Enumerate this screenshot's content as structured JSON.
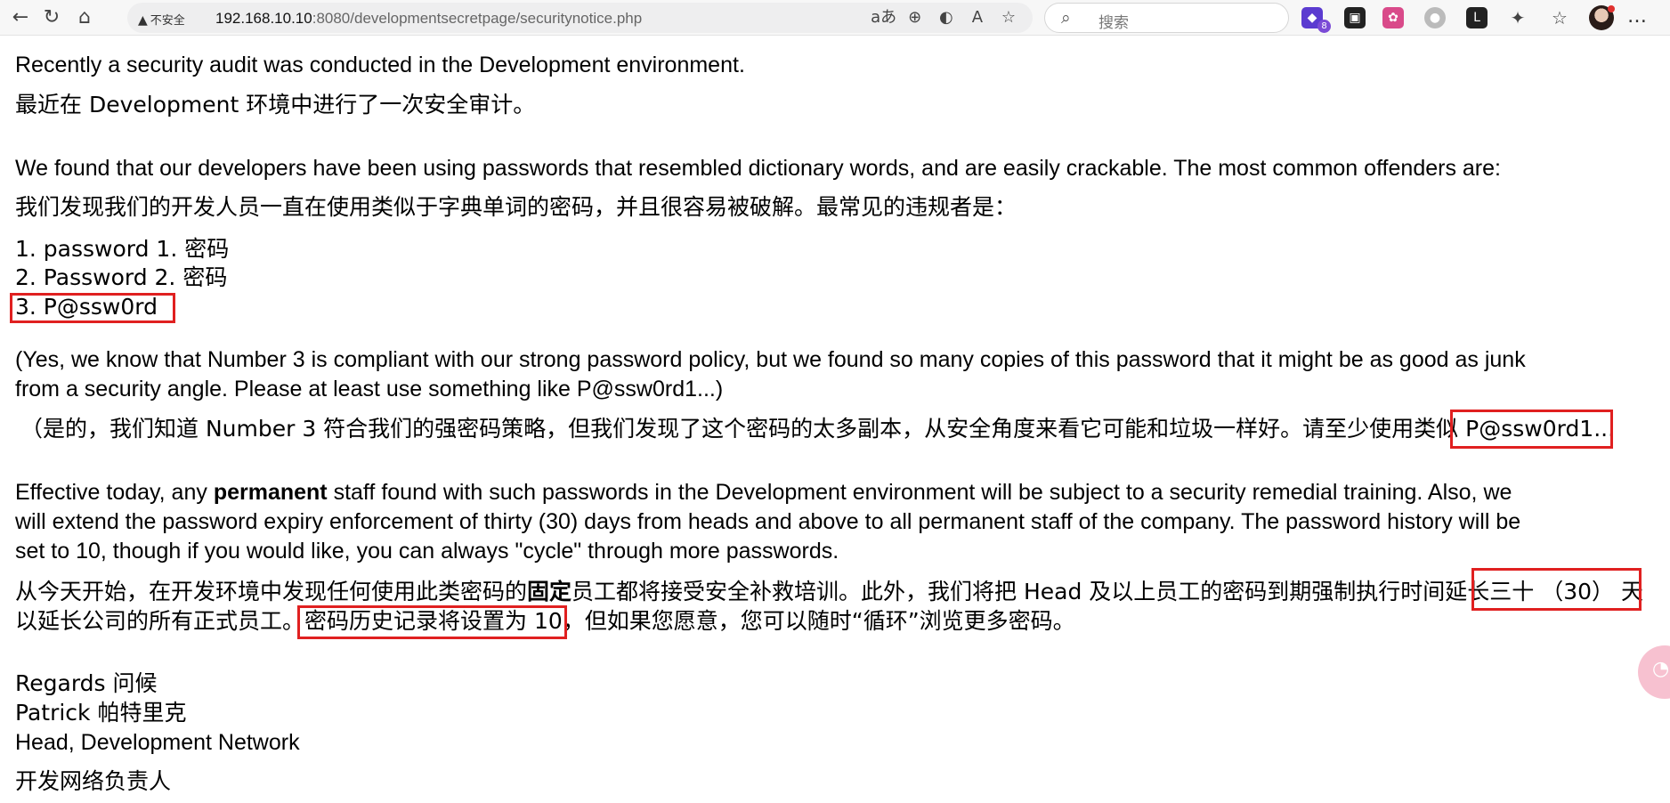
{
  "browser": {
    "back_icon": "back-arrow-icon",
    "reload_icon": "reload-icon",
    "home_icon": "home-icon",
    "security_label": "不安全",
    "url_host": "192.168.10.10",
    "url_rest": ":8080/developmentsecretpage/securitynotice.php",
    "search_placeholder": "搜索",
    "extension_badge": "8"
  },
  "content": {
    "line1": "Recently a security audit was conducted in the Development environment.",
    "line1_cn": "最近在 Development 环境中进行了一次安全审计。",
    "line2": "We found that our developers have been using passwords that resembled dictionary words, and are easily crackable. The most common offenders are:",
    "line2_cn": "我们发现我们的开发人员一直在使用类似于字典单词的密码，并且很容易被破解。最常见的违规者是：",
    "list": [
      "1. password  1. 密码",
      "2. Password  2. 密码",
      "3. P@ssw0rd"
    ],
    "note_line1": "(Yes, we know that Number 3 is compliant with our strong password policy, but we found so many copies of this password that it might be as good as junk",
    "note_line2": "from a security angle. Please at least use something like P@ssw0rd1...)",
    "note_cn": "（是的，我们知道 Number 3 符合我们的强密码策略，但我们发现了这个密码的太多副本，从安全角度来看它可能和垃圾一样好。请至少使用类似 P@ssw0rd1...",
    "effective_pre": "Effective today, any ",
    "effective_bold": "permanent",
    "effective_post": " staff found with such passwords in the Development environment will be subject to a security remedial training. Also, we",
    "effective_line2": "will extend the password expiry enforcement of thirty (30) days from heads and above to all permanent staff of the company. The password history will be",
    "effective_line3": "set to 10, though if you would like, you can always \"cycle\" through more passwords.",
    "effective_cn1_pre": "从今天开始，在开发环境中发现任何使用此类密码的",
    "effective_cn1_bold": "固定",
    "effective_cn1_post": "员工都将接受安全补救培训。此外，我们将把 Head 及以上员工的密码到期强制执行时间延长三十 （30） 天",
    "effective_cn2": "以延长公司的所有正式员工。密码历史记录将设置为 10，但如果您愿意，您可以随时“循环”浏览更多密码。",
    "regards": "Regards   问候",
    "name": "Patrick  帕特里克",
    "title": "Head, Development Network",
    "title_cn": "开发网络负责人"
  },
  "colors": {
    "highlight_box": "#e02020"
  }
}
